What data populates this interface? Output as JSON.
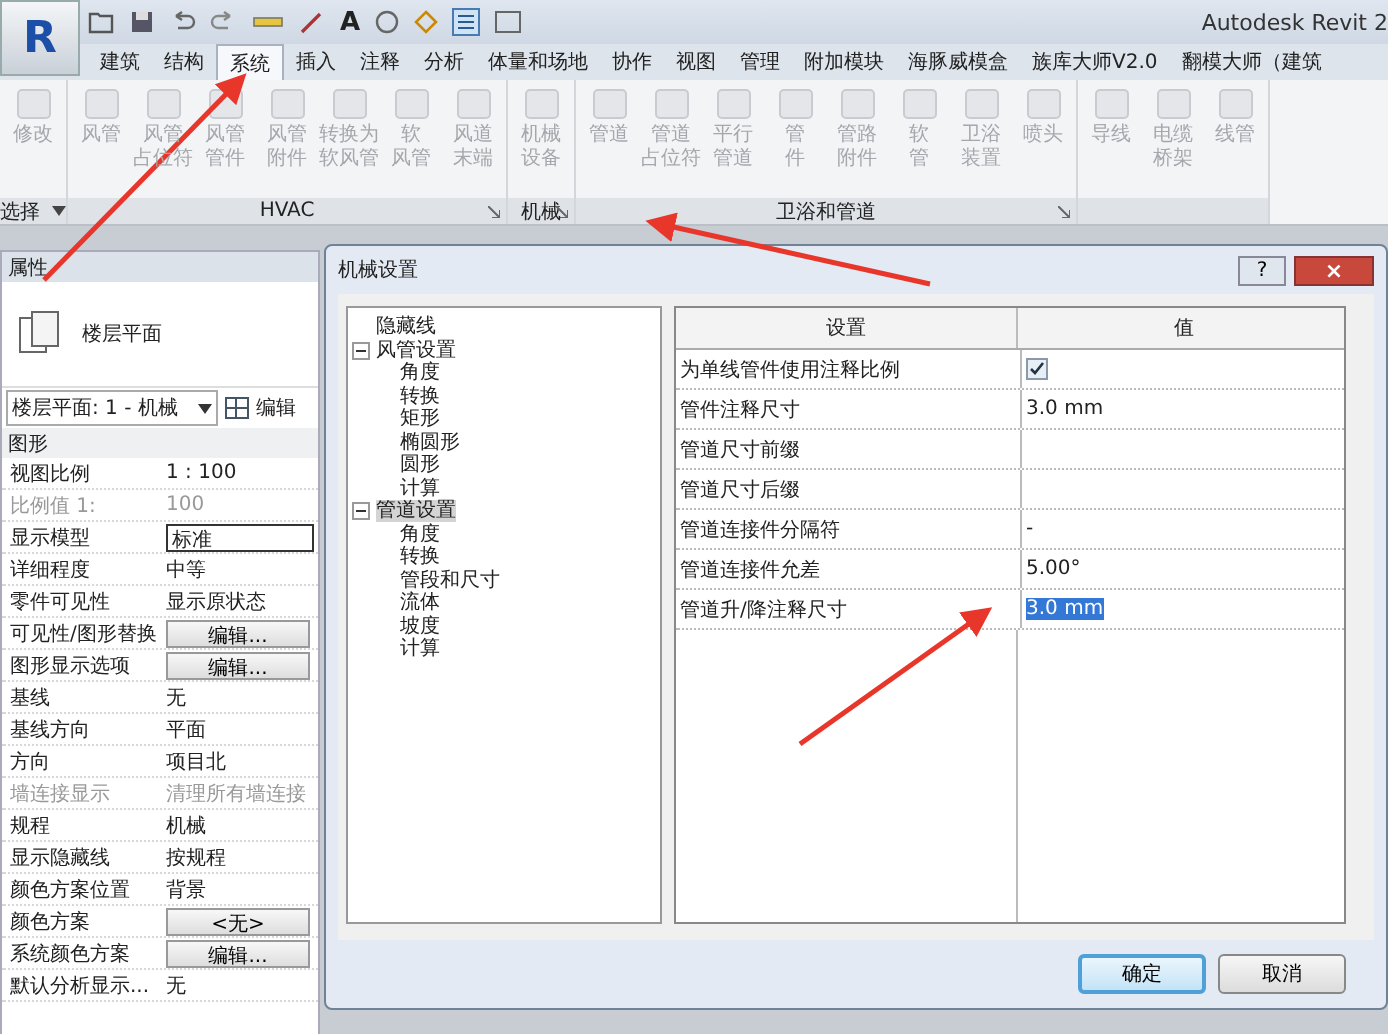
{
  "app_button": {
    "label": "R"
  },
  "quick_access": {
    "text_tool": "A"
  },
  "window": {
    "title": "Autodesk Revit 2"
  },
  "tabs": [
    {
      "label": "建筑",
      "selected": false
    },
    {
      "label": "结构",
      "selected": false
    },
    {
      "label": "系统",
      "selected": true
    },
    {
      "label": "插入",
      "selected": false
    },
    {
      "label": "注释",
      "selected": false
    },
    {
      "label": "分析",
      "selected": false
    },
    {
      "label": "体量和场地",
      "selected": false
    },
    {
      "label": "协作",
      "selected": false
    },
    {
      "label": "视图",
      "selected": false
    },
    {
      "label": "管理",
      "selected": false
    },
    {
      "label": "附加模块",
      "selected": false
    },
    {
      "label": "海豚威模盒",
      "selected": false
    },
    {
      "label": "族库大师V2.0",
      "selected": false
    },
    {
      "label": "翻模大师（建筑",
      "selected": false
    }
  ],
  "ribbon_panels": [
    {
      "label": "选择",
      "dropdown": true,
      "buttons": [
        {
          "lines": [
            "修改"
          ],
          "disabled": true
        }
      ]
    },
    {
      "label": "HVAC",
      "launcher": true,
      "buttons": [
        {
          "lines": [
            "风管"
          ],
          "disabled": true
        },
        {
          "lines": [
            "风管",
            "占位符"
          ],
          "disabled": true
        },
        {
          "lines": [
            "风管",
            "管件"
          ],
          "disabled": true
        },
        {
          "lines": [
            "风管",
            "附件"
          ],
          "disabled": true
        },
        {
          "lines": [
            "转换为",
            "软风管"
          ],
          "disabled": true
        },
        {
          "lines": [
            "软",
            "风管"
          ],
          "disabled": true
        },
        {
          "lines": [
            "风道",
            "末端"
          ],
          "disabled": true
        }
      ]
    },
    {
      "label": "机械",
      "launcher": true,
      "buttons": [
        {
          "lines": [
            "机械",
            "设备"
          ],
          "disabled": true
        }
      ]
    },
    {
      "label": "卫浴和管道",
      "launcher": true,
      "buttons": [
        {
          "lines": [
            "管道"
          ],
          "disabled": true
        },
        {
          "lines": [
            "管道",
            "占位符"
          ],
          "disabled": true
        },
        {
          "lines": [
            "平行",
            "管道"
          ],
          "disabled": true
        },
        {
          "lines": [
            "管",
            "件"
          ],
          "disabled": true
        },
        {
          "lines": [
            "管路",
            "附件"
          ],
          "disabled": true
        },
        {
          "lines": [
            "软",
            "管"
          ],
          "disabled": true
        },
        {
          "lines": [
            "卫浴",
            "装置"
          ],
          "disabled": true
        },
        {
          "lines": [
            "喷头"
          ],
          "disabled": true
        }
      ]
    },
    {
      "buttons": [
        {
          "lines": [
            "导线"
          ],
          "disabled": true
        },
        {
          "lines": [
            "电缆",
            "桥架"
          ],
          "disabled": true
        },
        {
          "lines": [
            "线管"
          ],
          "disabled": true
        }
      ]
    }
  ],
  "properties": {
    "title": "属性",
    "type_name": "楼层平面",
    "view_selector": "楼层平面: 1 - 机械",
    "edit_type": "编辑",
    "section": "图形",
    "rows": [
      {
        "kind": "text",
        "name": "视图比例",
        "value": "1 : 100",
        "disabled": false
      },
      {
        "kind": "text",
        "name": "比例值 1:",
        "value": "100",
        "disabled": true
      },
      {
        "kind": "field",
        "name": "显示模型",
        "value": "标准",
        "disabled": false
      },
      {
        "kind": "text",
        "name": "详细程度",
        "value": "中等",
        "disabled": false
      },
      {
        "kind": "text",
        "name": "零件可见性",
        "value": "显示原状态",
        "disabled": false
      },
      {
        "kind": "button",
        "name": "可见性/图形替换",
        "value": "编辑...",
        "disabled": false
      },
      {
        "kind": "button",
        "name": "图形显示选项",
        "value": "编辑...",
        "disabled": false
      },
      {
        "kind": "text",
        "name": "基线",
        "value": "无",
        "disabled": false
      },
      {
        "kind": "text",
        "name": "基线方向",
        "value": "平面",
        "disabled": false
      },
      {
        "kind": "text",
        "name": "方向",
        "value": "项目北",
        "disabled": false
      },
      {
        "kind": "text",
        "name": "墙连接显示",
        "value": "清理所有墙连接",
        "disabled": true
      },
      {
        "kind": "text",
        "name": "规程",
        "value": "机械",
        "disabled": false
      },
      {
        "kind": "text",
        "name": "显示隐藏线",
        "value": "按规程",
        "disabled": false
      },
      {
        "kind": "text",
        "name": "颜色方案位置",
        "value": "背景",
        "disabled": false
      },
      {
        "kind": "button",
        "name": "颜色方案",
        "value": "<无>",
        "disabled": false
      },
      {
        "kind": "button",
        "name": "系统颜色方案",
        "value": "编辑...",
        "disabled": false
      },
      {
        "kind": "text",
        "name": "默认分析显示...",
        "value": "无",
        "disabled": false
      }
    ]
  },
  "dialog": {
    "title": "机械设置",
    "help": "?",
    "close": "×",
    "tree": [
      {
        "label": "隐藏线",
        "selected": false
      },
      {
        "label": "风管设置",
        "selected": false,
        "expanded": true,
        "children": [
          {
            "label": "角度",
            "selected": false
          },
          {
            "label": "转换",
            "selected": false
          },
          {
            "label": "矩形",
            "selected": false
          },
          {
            "label": "椭圆形",
            "selected": false
          },
          {
            "label": "圆形",
            "selected": false
          },
          {
            "label": "计算",
            "selected": false
          }
        ]
      },
      {
        "label": "管道设置",
        "selected": true,
        "expanded": true,
        "children": [
          {
            "label": "角度",
            "selected": false
          },
          {
            "label": "转换",
            "selected": false
          },
          {
            "label": "管段和尺寸",
            "selected": false
          },
          {
            "label": "流体",
            "selected": false
          },
          {
            "label": "坡度",
            "selected": false
          },
          {
            "label": "计算",
            "selected": false
          }
        ]
      }
    ],
    "table": {
      "columns": [
        "设置",
        "值"
      ],
      "rows": [
        {
          "kind": "checkbox",
          "name": "为单线管件使用注释比例",
          "checked": true
        },
        {
          "kind": "text",
          "name": "管件注释尺寸",
          "value": "3.0 mm",
          "selected": false
        },
        {
          "kind": "text",
          "name": "管道尺寸前缀"
        },
        {
          "kind": "text",
          "name": "管道尺寸后缀"
        },
        {
          "kind": "text",
          "name": "管道连接件分隔符",
          "value": "-",
          "selected": false
        },
        {
          "kind": "text",
          "name": "管道连接件允差",
          "value": "5.00°",
          "selected": false
        },
        {
          "kind": "text",
          "name": "管道升/降注释尺寸",
          "value": "3.0 mm",
          "selected": true
        }
      ]
    },
    "buttons": [
      {
        "label": "确定",
        "focused": true
      },
      {
        "label": "取消",
        "focused": false
      }
    ]
  }
}
